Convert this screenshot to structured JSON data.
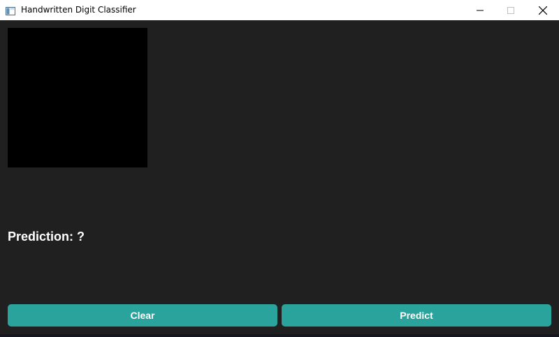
{
  "window": {
    "title": "Handwritten Digit Classifier",
    "icon": "app-window-icon",
    "controls": [
      "minimize-icon",
      "maximize-icon",
      "close-icon"
    ]
  },
  "canvas": {
    "background": "#000000"
  },
  "prediction": {
    "label": "Prediction: ?"
  },
  "buttons": {
    "clear_label": "Clear",
    "predict_label": "Predict",
    "color": "#29a39c"
  },
  "theme": {
    "background": "#202020",
    "text": "#ffffff"
  }
}
